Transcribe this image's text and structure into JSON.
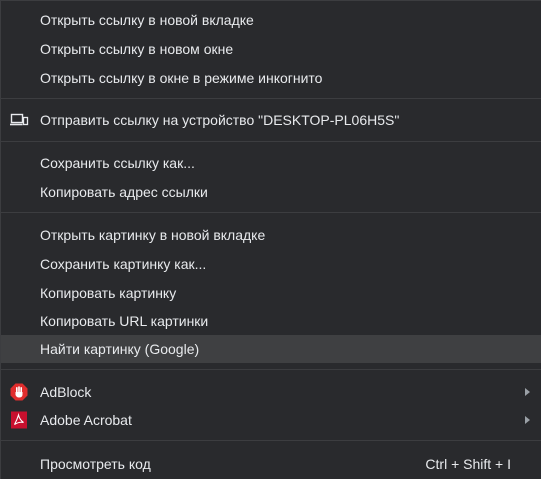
{
  "menu": {
    "items": {
      "open_new_tab": "Открыть ссылку в новой вкладке",
      "open_new_window": "Открыть ссылку в новом окне",
      "open_incognito": "Открыть ссылку в окне в режиме инкогнито",
      "send_to_device": "Отправить ссылку на устройство \"DESKTOP-PL06H5S\"",
      "save_link_as": "Сохранить ссылку как...",
      "copy_link_address": "Копировать адрес ссылки",
      "open_image_new_tab": "Открыть картинку в новой вкладке",
      "save_image_as": "Сохранить картинку как...",
      "copy_image": "Копировать картинку",
      "copy_image_url": "Копировать URL картинки",
      "search_image_google": "Найти картинку (Google)",
      "adblock": "AdBlock",
      "adobe_acrobat": "Adobe Acrobat",
      "inspect": "Просмотреть код"
    },
    "shortcuts": {
      "inspect": "Ctrl + Shift + I"
    },
    "icons": {
      "send_to_device": "laptop-phone-icon",
      "adblock": "adblock-hand-icon",
      "adobe_acrobat": "acrobat-pdf-icon"
    },
    "colors": {
      "background": "#292a2d",
      "hover": "#3f4042",
      "separator": "#3c3d40",
      "text": "#e8eaed",
      "adblock_red": "#e02d2d",
      "acrobat_red": "#c8102e"
    }
  }
}
